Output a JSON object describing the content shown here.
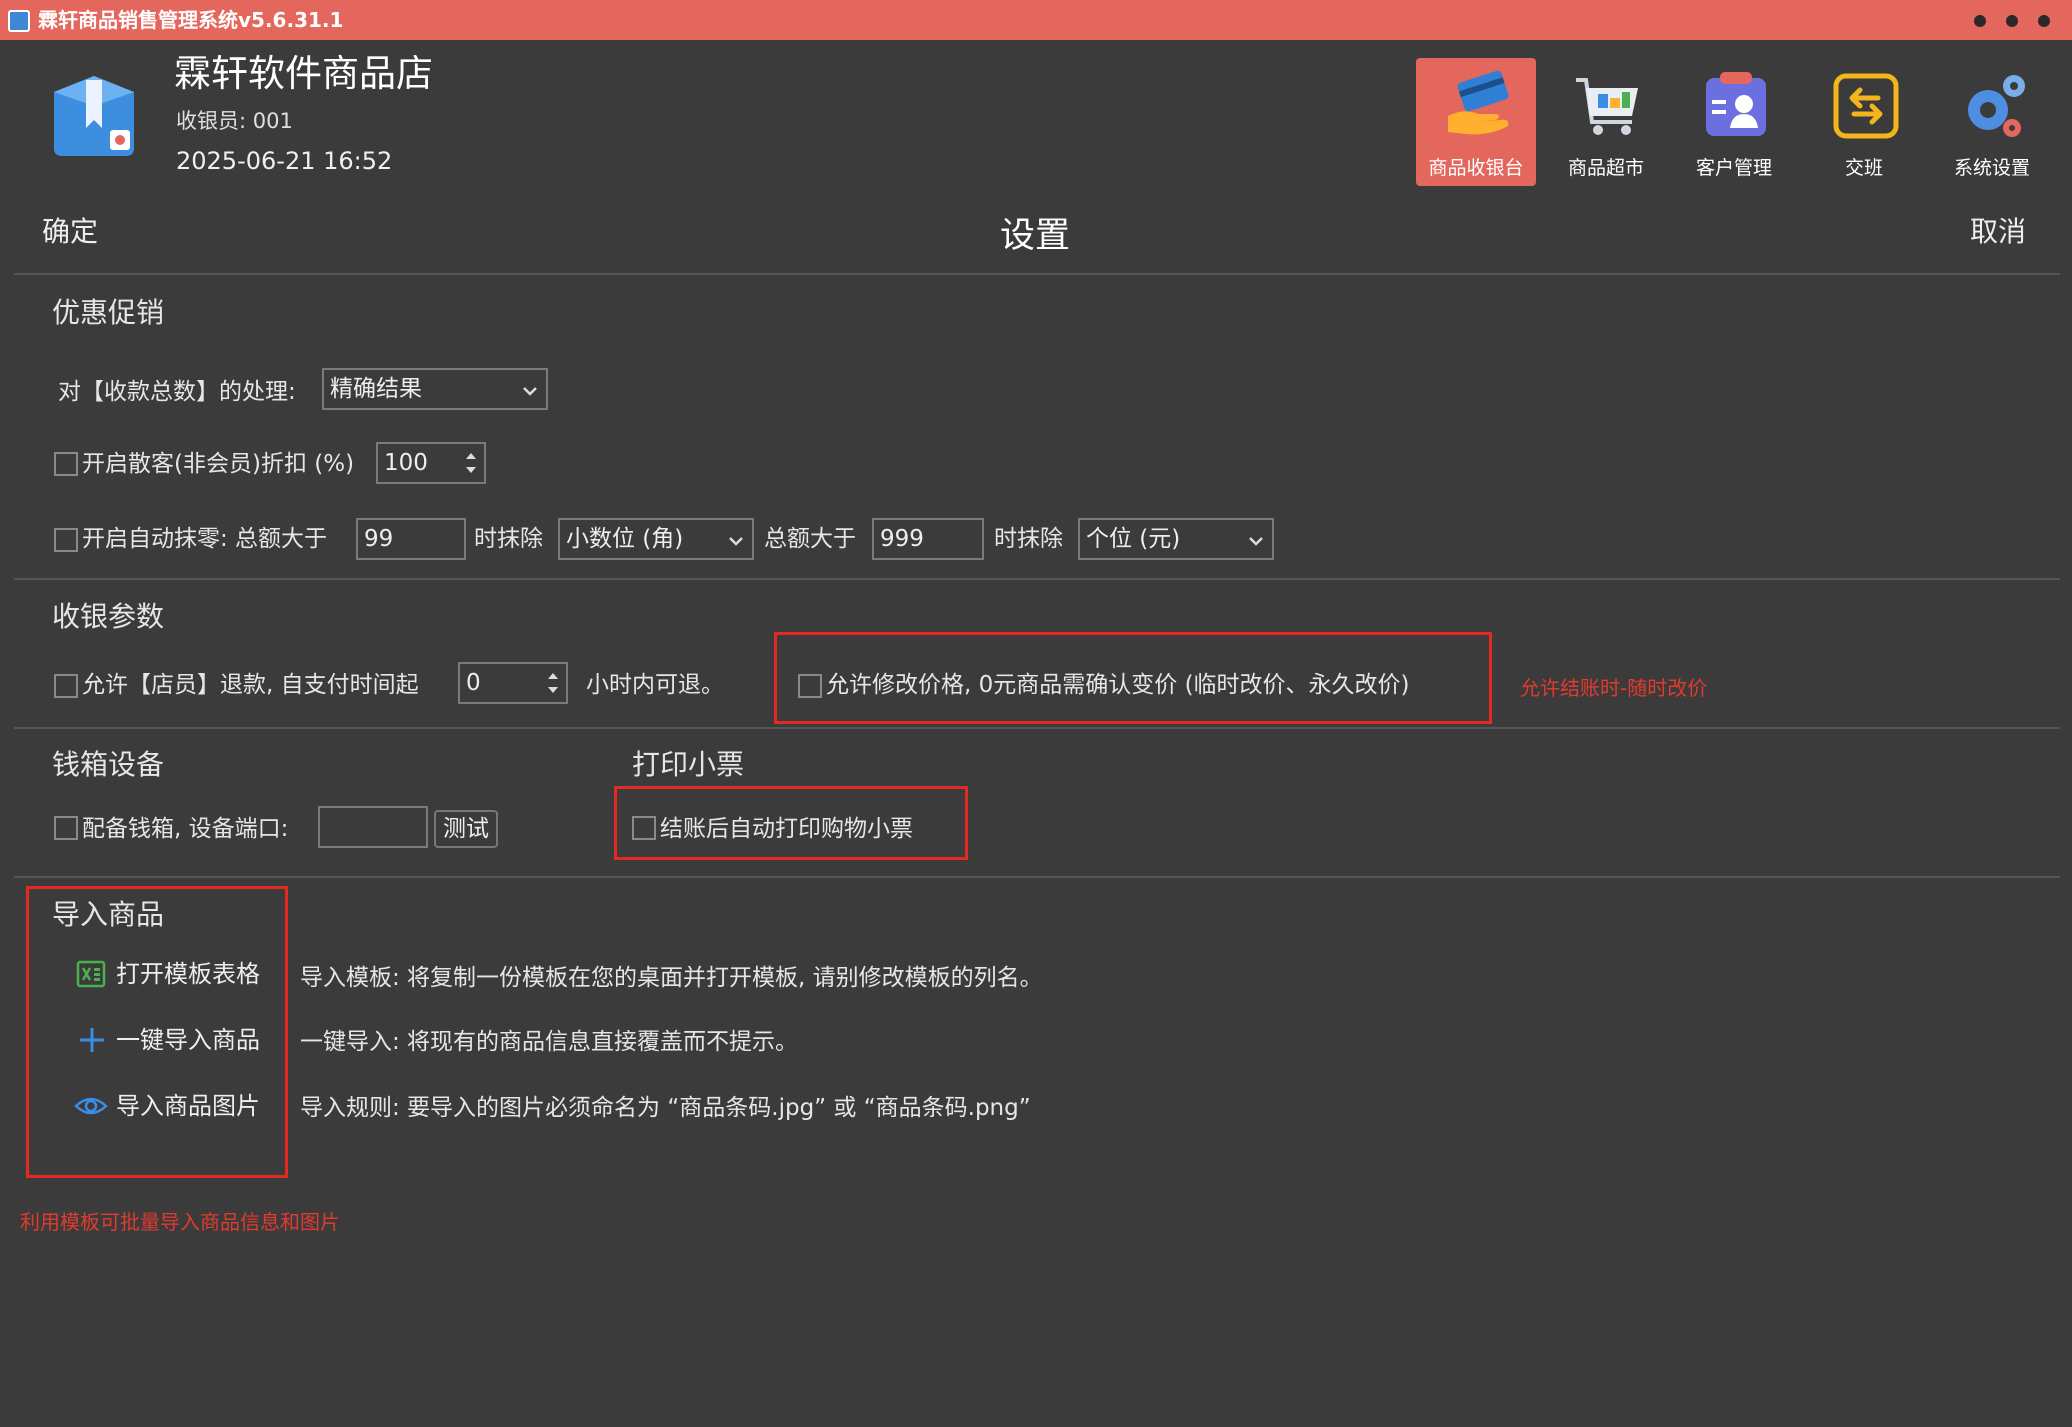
{
  "window": {
    "title": "霖轩商品销售管理系统v5.6.31.1"
  },
  "header": {
    "store_name": "霖轩软件商品店",
    "cashier_label": "收银员: 001",
    "datetime": "2025-06-21 16:52"
  },
  "nav": [
    {
      "label": "商品收银台",
      "icon": "card-hand-icon",
      "active": true
    },
    {
      "label": "商品超市",
      "icon": "shopping-cart-icon",
      "active": false
    },
    {
      "label": "客户管理",
      "icon": "customer-card-icon",
      "active": false
    },
    {
      "label": "交班",
      "icon": "shift-swap-icon",
      "active": false
    },
    {
      "label": "系统设置",
      "icon": "gears-icon",
      "active": false
    }
  ],
  "toolbar": {
    "confirm_label": "确定",
    "title": "设置",
    "cancel_label": "取消"
  },
  "promo": {
    "section_title": "优惠促销",
    "total_handling_label": "对【收款总数】的处理:",
    "total_handling_value": "精确结果",
    "discount_label": "开启散客(非会员)折扣 (%)",
    "discount_value": "100",
    "rounding_label": "开启自动抹零: 总额大于",
    "rounding_amount1": "99",
    "rounding_erase1_label": "时抹除",
    "rounding_erase1_value": "小数位 (角)",
    "rounding_total2_label": "总额大于",
    "rounding_amount2": "999",
    "rounding_erase2_label": "时抹除",
    "rounding_erase2_value": "个位 (元)"
  },
  "cashier_params": {
    "section_title": "收银参数",
    "refund_label": "允许【店员】退款, 自支付时间起",
    "refund_hours": "0",
    "refund_suffix": "小时内可退。",
    "price_change_label": "允许修改价格, 0元商品需确认变价 (临时改价、永久改价)",
    "price_change_note": "允许结账时-随时改价"
  },
  "cash_drawer": {
    "section_title": "钱箱设备",
    "drawer_label": "配备钱箱, 设备端口:",
    "port_value": "",
    "test_label": "测试"
  },
  "receipt": {
    "section_title": "打印小票",
    "auto_print_label": "结账后自动打印购物小票"
  },
  "import": {
    "section_title": "导入商品",
    "open_template_label": "打开模板表格",
    "one_click_label": "一键导入商品",
    "import_images_label": "导入商品图片",
    "template_desc": "导入模板: 将复制一份模板在您的桌面并打开模板, 请别修改模板的列名。",
    "one_click_desc": "一键导入: 将现有的商品信息直接覆盖而不提示。",
    "rule_desc": "导入规则: 要导入的图片必须命名为 “商品条码.jpg” 或 “商品条码.png”",
    "note": "利用模板可批量导入商品信息和图片"
  },
  "colors": {
    "accent": "#e4675e",
    "background": "#3b3b3b",
    "highlight_border": "#e02b20"
  }
}
